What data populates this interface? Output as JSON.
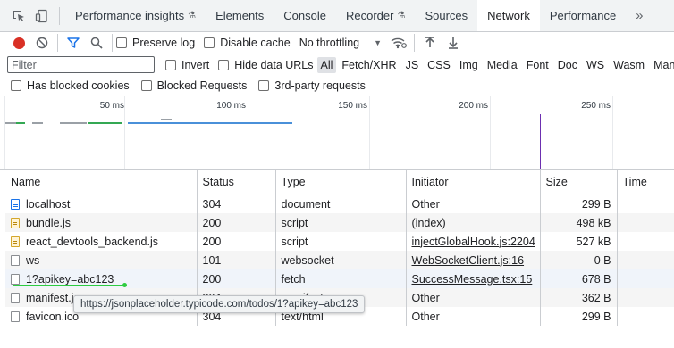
{
  "tabs": [
    {
      "label": "Performance insights",
      "experimental": true
    },
    {
      "label": "Elements"
    },
    {
      "label": "Console"
    },
    {
      "label": "Recorder",
      "experimental": true
    },
    {
      "label": "Sources"
    },
    {
      "label": "Network",
      "active": true
    },
    {
      "label": "Performance"
    }
  ],
  "toolbar": {
    "preserve_log": "Preserve log",
    "disable_cache": "Disable cache",
    "throttling": "No throttling"
  },
  "filter": {
    "placeholder": "Filter",
    "invert": "Invert",
    "hide_data_urls": "Hide data URLs",
    "types": [
      "All",
      "Fetch/XHR",
      "JS",
      "CSS",
      "Img",
      "Media",
      "Font",
      "Doc",
      "WS",
      "Wasm",
      "Manifest"
    ],
    "active_type": "All",
    "has_blocked_cookies": "Has blocked cookies",
    "blocked_requests": "Blocked Requests",
    "third_party": "3rd-party requests"
  },
  "overview": {
    "ticks": [
      "50 ms",
      "100 ms",
      "150 ms",
      "200 ms",
      "250 ms"
    ]
  },
  "table": {
    "columns": [
      "Name",
      "Status",
      "Type",
      "Initiator",
      "Size",
      "Time"
    ],
    "rows": [
      {
        "name": "localhost",
        "icon": "document-icon",
        "status": "304",
        "type": "document",
        "initiator": "Other",
        "initiator_link": false,
        "size": "299 B"
      },
      {
        "name": "bundle.js",
        "icon": "script-icon",
        "status": "200",
        "type": "script",
        "initiator": "(index)",
        "initiator_link": true,
        "size": "498 kB"
      },
      {
        "name": "react_devtools_backend.js",
        "icon": "script-icon",
        "status": "200",
        "type": "script",
        "initiator": "injectGlobalHook.js:2204",
        "initiator_link": true,
        "size": "527 kB"
      },
      {
        "name": "ws",
        "icon": "file-icon",
        "status": "101",
        "type": "websocket",
        "initiator": "WebSocketClient.js:16",
        "initiator_link": true,
        "size": "0 B"
      },
      {
        "name": "1?apikey=abc123",
        "icon": "file-icon",
        "status": "200",
        "type": "fetch",
        "initiator": "SuccessMessage.tsx:15",
        "initiator_link": true,
        "size": "678 B"
      },
      {
        "name": "manifest.json",
        "icon": "file-icon",
        "status": "304",
        "type": "manifest",
        "initiator": "Other",
        "initiator_link": false,
        "size": "362 B"
      },
      {
        "name": "favicon.ico",
        "icon": "file-icon",
        "status": "304",
        "type": "text/html",
        "initiator": "Other",
        "initiator_link": false,
        "size": "299 B"
      }
    ]
  },
  "tooltip": "https://jsonplaceholder.typicode.com/todos/1?apikey=abc123",
  "colors": {
    "record": "#d93025",
    "accent": "#1a73e8",
    "drag_line": "#2ecc40",
    "overview_green": "#34a853",
    "overview_blue": "#4a90d9"
  }
}
